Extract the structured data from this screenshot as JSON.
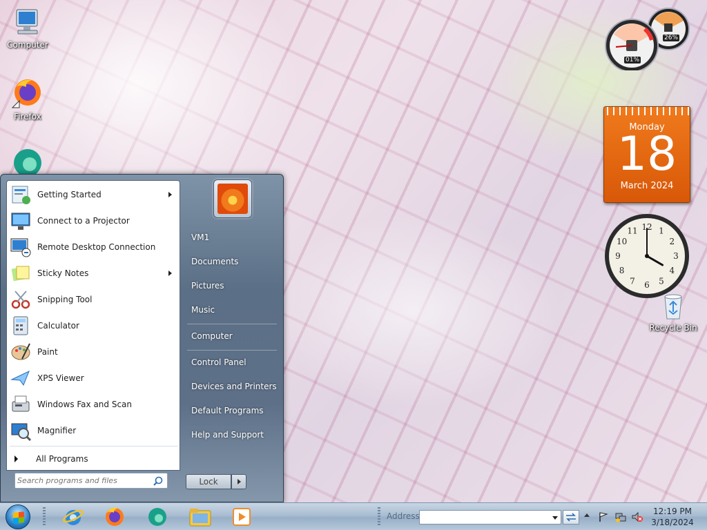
{
  "desktop": {
    "icons": [
      {
        "label": "Computer",
        "icon": "computer-icon"
      },
      {
        "label": "Firefox",
        "icon": "firefox-icon"
      },
      {
        "label": "Recycle Bin",
        "icon": "recycle-bin-icon"
      }
    ]
  },
  "gadgets": {
    "cpu_meter": {
      "cpu": "01%",
      "memory": "26%"
    },
    "calendar": {
      "weekday": "Monday",
      "day": "18",
      "month_year": "March 2024"
    },
    "clock": {
      "numbers": [
        "12",
        "1",
        "2",
        "3",
        "4",
        "5",
        "6",
        "7",
        "8",
        "9",
        "10",
        "11"
      ],
      "hour": 4,
      "minute": 0
    }
  },
  "start_menu": {
    "programs": [
      {
        "label": "Getting Started",
        "icon": "getting-started-icon",
        "submenu": true
      },
      {
        "label": "Connect to a Projector",
        "icon": "projector-icon",
        "submenu": false
      },
      {
        "label": "Remote Desktop Connection",
        "icon": "remote-desktop-icon",
        "submenu": false
      },
      {
        "label": "Sticky Notes",
        "icon": "sticky-notes-icon",
        "submenu": true
      },
      {
        "label": "Snipping Tool",
        "icon": "scissors-icon",
        "submenu": false
      },
      {
        "label": "Calculator",
        "icon": "calculator-icon",
        "submenu": false
      },
      {
        "label": "Paint",
        "icon": "paint-palette-icon",
        "submenu": false
      },
      {
        "label": "XPS Viewer",
        "icon": "xps-viewer-icon",
        "submenu": false
      },
      {
        "label": "Windows Fax and Scan",
        "icon": "fax-icon",
        "submenu": false
      },
      {
        "label": "Magnifier",
        "icon": "magnifier-icon",
        "submenu": false
      }
    ],
    "all_programs": "All Programs",
    "search_placeholder": "Search programs and files",
    "right_links": [
      "VM1",
      "Documents",
      "Pictures",
      "Music",
      "Computer",
      "Control Panel",
      "Devices and Printers",
      "Default Programs",
      "Help and Support"
    ],
    "lock_label": "Lock"
  },
  "taskbar": {
    "pinned": [
      "ie-icon",
      "firefox-icon",
      "edge-icon",
      "explorer-icon",
      "media-player-icon"
    ],
    "address_label": "Address",
    "address_value": "",
    "time": "12:19 PM",
    "date": "3/18/2024"
  }
}
